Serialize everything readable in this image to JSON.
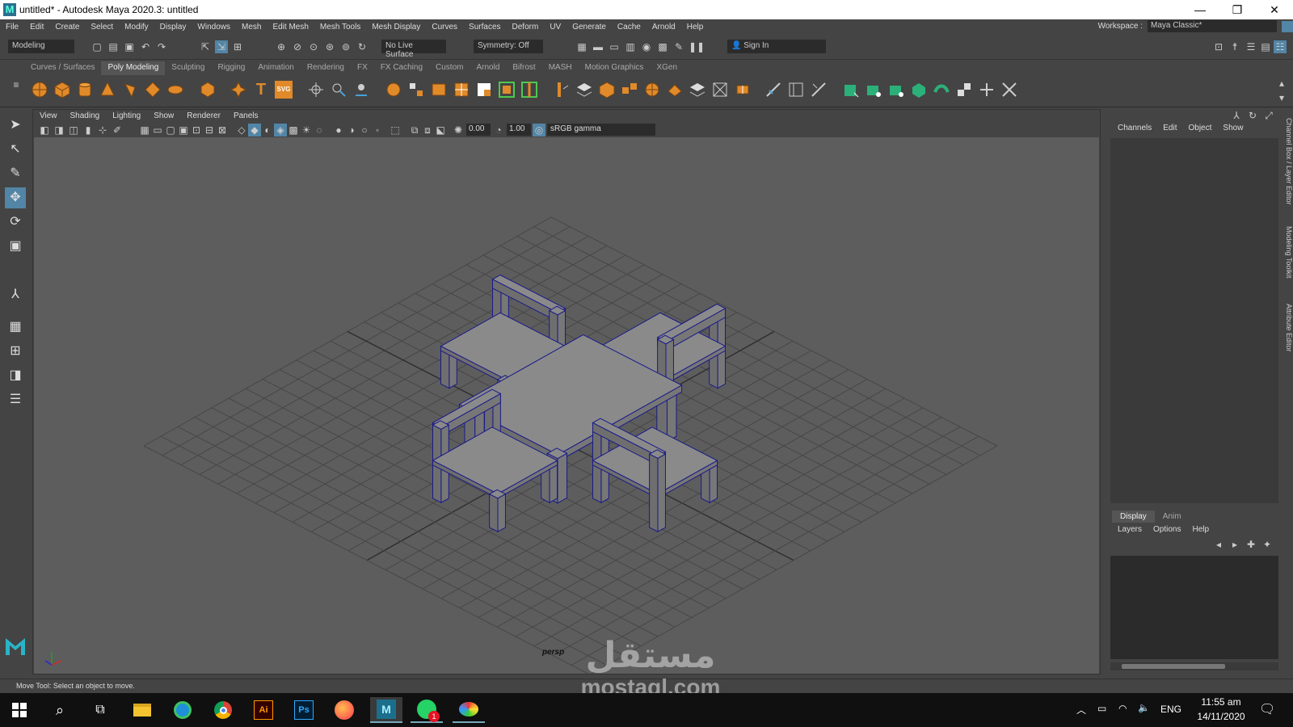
{
  "app": {
    "title": "untitled* - Autodesk Maya 2020.3: untitled"
  },
  "window_controls": {
    "minimize": "—",
    "restore": "❐",
    "close": "✕"
  },
  "menubar": {
    "items": [
      "File",
      "Edit",
      "Create",
      "Select",
      "Modify",
      "Display",
      "Windows",
      "Mesh",
      "Edit Mesh",
      "Mesh Tools",
      "Mesh Display",
      "Curves",
      "Surfaces",
      "Deform",
      "UV",
      "Generate",
      "Cache",
      "Arnold",
      "Help"
    ],
    "workspace_label": "Workspace :",
    "workspace_value": "Maya Classic*"
  },
  "statusline": {
    "mode": "Modeling",
    "live_surface": "No Live Surface",
    "symmetry": "Symmetry: Off",
    "sign_in": "Sign In"
  },
  "shelf": {
    "tabs": [
      "Curves / Surfaces",
      "Poly Modeling",
      "Sculpting",
      "Rigging",
      "Animation",
      "Rendering",
      "FX",
      "FX Caching",
      "Custom",
      "Arnold",
      "Bifrost",
      "MASH",
      "Motion Graphics",
      "XGen"
    ],
    "active_tab": "Poly Modeling",
    "svg_label": "SVG",
    "text_label": "T"
  },
  "panel": {
    "menu": [
      "View",
      "Shading",
      "Lighting",
      "Show",
      "Renderer",
      "Panels"
    ],
    "exposure": "0.00",
    "gamma": "1.00",
    "color_space": "sRGB gamma",
    "camera_label": "persp"
  },
  "channel_box": {
    "menu": [
      "Channels",
      "Edit",
      "Object",
      "Show"
    ]
  },
  "layer_editor": {
    "tabs": [
      "Display",
      "Anim"
    ],
    "active_tab": "Display",
    "menu": [
      "Layers",
      "Options",
      "Help"
    ]
  },
  "side_tabs": [
    "Channel Box / Layer Editor",
    "Modeling Toolkit",
    "Attribute Editor"
  ],
  "help_line": "Move Tool: Select an object to move.",
  "taskbar": {
    "time": "11:55 am",
    "date": "14/11/2020",
    "lang": "ENG",
    "badge": "1"
  },
  "watermark": {
    "arabic": "مستقل",
    "latin": "mostaql.com"
  },
  "colors": {
    "wire": "#1a1a8a",
    "selected_tool": "#5285a6",
    "viewport_bg": "#5d5d5d",
    "chair_fill": "#7d7d7d"
  }
}
